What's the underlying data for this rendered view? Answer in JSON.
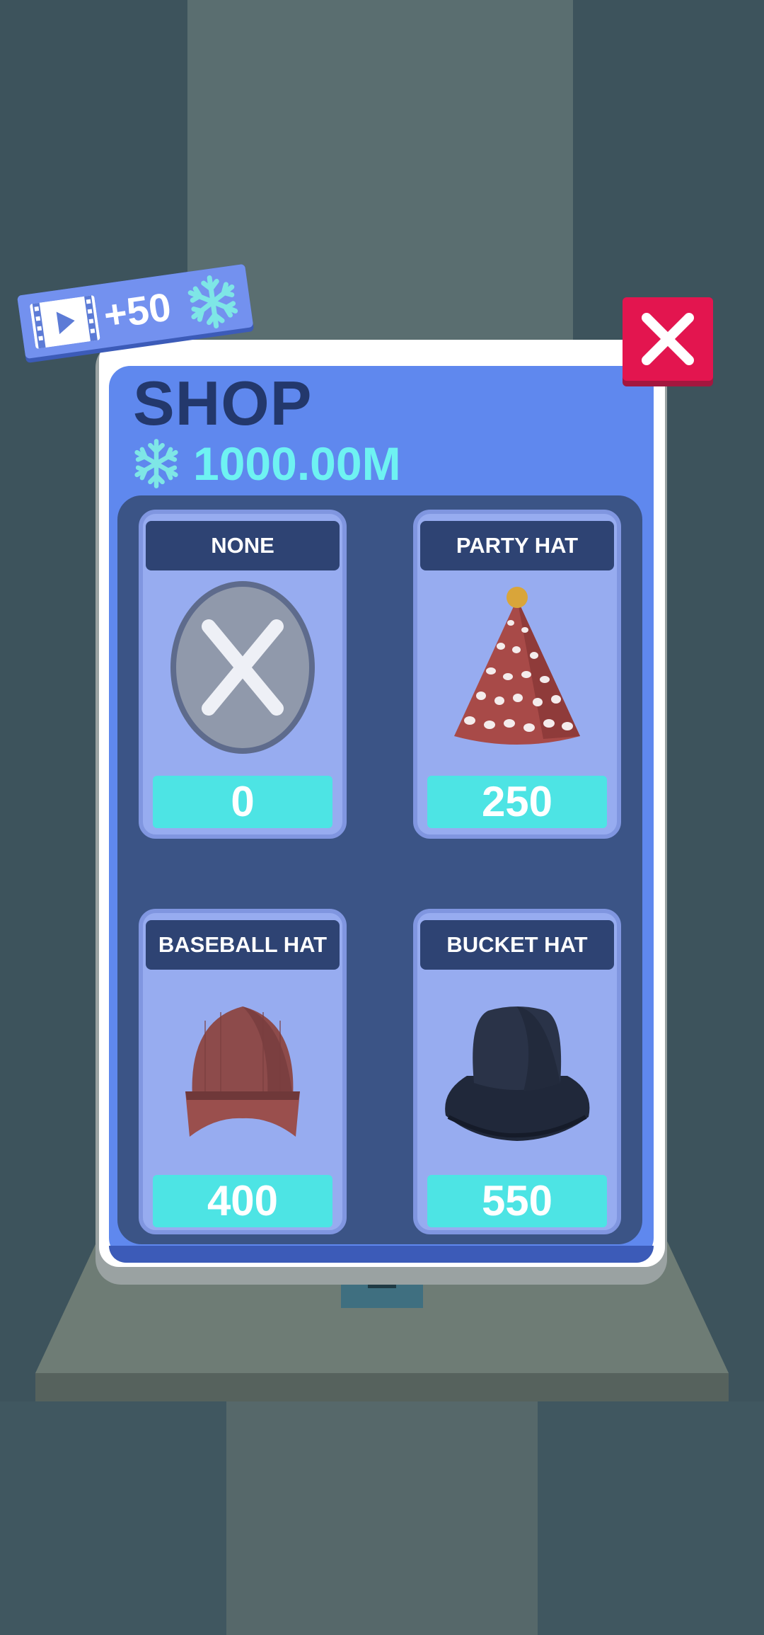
{
  "shop": {
    "title": "SHOP",
    "currency_amount": "1000.00M",
    "currency_icon": "snowflake-icon"
  },
  "ad_reward": {
    "label": "+50",
    "icon": "video-play-icon",
    "currency_icon": "snowflake-icon"
  },
  "close_icon": "close-icon",
  "items": [
    {
      "name": "NONE",
      "price": "0",
      "image": "no-hat-x-icon"
    },
    {
      "name": "PARTY HAT",
      "price": "250",
      "image": "party-hat-image"
    },
    {
      "name": "BASEBALL HAT",
      "price": "400",
      "image": "baseball-hat-image"
    },
    {
      "name": "BUCKET HAT",
      "price": "550",
      "image": "bucket-hat-image"
    }
  ],
  "colors": {
    "panel": "#5f88ee",
    "grid": "#3b5486",
    "card": "#97acf0",
    "price_bar": "#4de4e4",
    "currency_text": "#6ef2f2",
    "close_button": "#e3154f",
    "title": "#23386c"
  }
}
